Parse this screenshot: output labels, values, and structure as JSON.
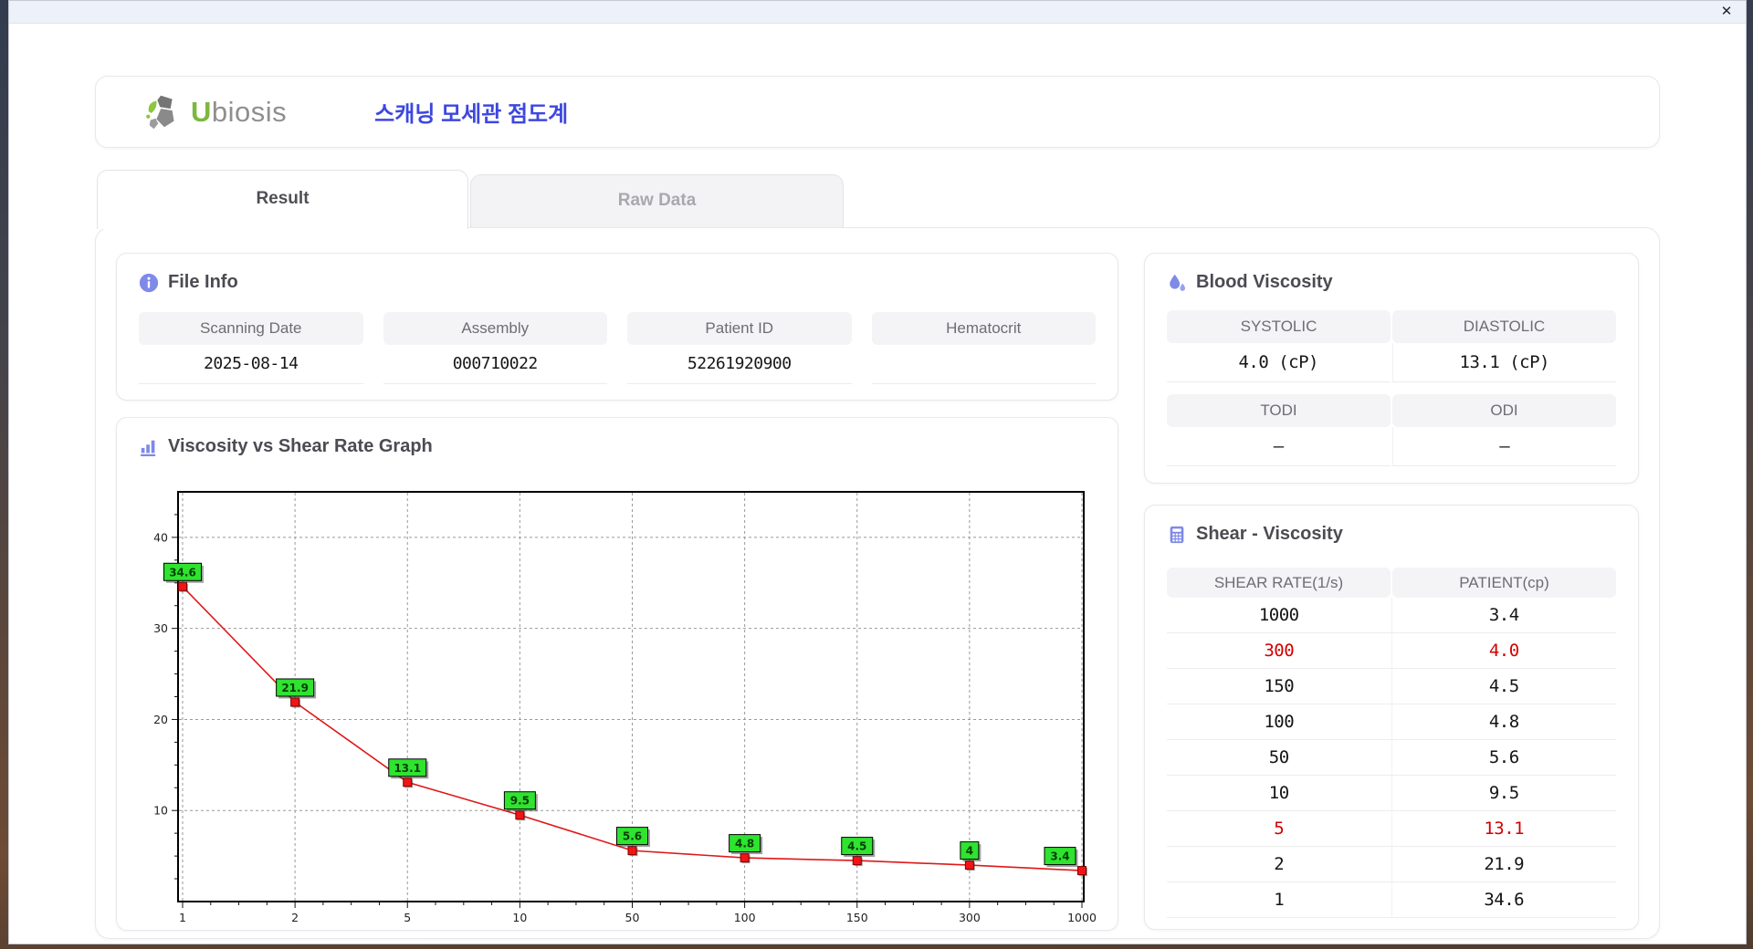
{
  "window": {
    "close_label": "✕"
  },
  "header": {
    "brand_u": "U",
    "brand_rest": "biosis",
    "app_title": "스캐닝 모세관 점도계"
  },
  "tabs": [
    {
      "label": "Result",
      "active": true
    },
    {
      "label": "Raw Data",
      "active": false
    }
  ],
  "file_info": {
    "title": "File Info",
    "fields": [
      {
        "label": "Scanning Date",
        "value": "2025-08-14"
      },
      {
        "label": "Assembly",
        "value": "000710022"
      },
      {
        "label": "Patient ID",
        "value": "52261920900"
      },
      {
        "label": "Hematocrit",
        "value": ""
      }
    ]
  },
  "blood_viscosity": {
    "title": "Blood Viscosity",
    "groups": [
      {
        "cells": [
          {
            "label": "SYSTOLIC",
            "value": "4.0 (cP)"
          },
          {
            "label": "DIASTOLIC",
            "value": "13.1 (cP)"
          }
        ]
      },
      {
        "cells": [
          {
            "label": "TODI",
            "value": "–"
          },
          {
            "label": "ODI",
            "value": "–"
          }
        ]
      }
    ]
  },
  "chart_data": {
    "type": "line",
    "title": "Viscosity vs Shear Rate Graph",
    "xlabel": "",
    "ylabel": "",
    "x_values": [
      1,
      2,
      5,
      10,
      50,
      100,
      150,
      300,
      1000
    ],
    "x_tick_labels": [
      "1",
      "2",
      "5",
      "10",
      "50",
      "100",
      "150",
      "300",
      "1000"
    ],
    "series": [
      {
        "name": "PATIENT",
        "values": [
          34.6,
          21.9,
          13.1,
          9.5,
          5.6,
          4.8,
          4.5,
          4.0,
          3.4
        ],
        "point_labels": [
          "34.6",
          "21.9",
          "13.1",
          "9.5",
          "5.6",
          "4.8",
          "4.5",
          "4",
          "3.4"
        ]
      }
    ],
    "ylim": [
      0,
      45
    ],
    "y_ticks": [
      10,
      20,
      30,
      40
    ],
    "grid": true,
    "legend": false,
    "line_color": "#e01818",
    "marker_color": "#f21414",
    "marker_border": "#7d0000",
    "label_bg": "#2fe32f"
  },
  "shear_table": {
    "title": "Shear - Viscosity",
    "columns": [
      "SHEAR RATE(1/s)",
      "PATIENT(cp)"
    ],
    "rows": [
      {
        "shear": "1000",
        "patient": "3.4",
        "highlight": false
      },
      {
        "shear": "300",
        "patient": "4.0",
        "highlight": true
      },
      {
        "shear": "150",
        "patient": "4.5",
        "highlight": false
      },
      {
        "shear": "100",
        "patient": "4.8",
        "highlight": false
      },
      {
        "shear": "50",
        "patient": "5.6",
        "highlight": false
      },
      {
        "shear": "10",
        "patient": "9.5",
        "highlight": false
      },
      {
        "shear": "5",
        "patient": "13.1",
        "highlight": true
      },
      {
        "shear": "2",
        "patient": "21.9",
        "highlight": false
      },
      {
        "shear": "1",
        "patient": "34.6",
        "highlight": false
      }
    ]
  },
  "colors": {
    "accent_blue": "#3d47de",
    "brand_green": "#7cb83e",
    "icon_periwinkle": "#7f8ae8",
    "highlight_red": "#d40000",
    "titlebar": "#edf1f9",
    "header_gray": "#f4f4f6"
  }
}
